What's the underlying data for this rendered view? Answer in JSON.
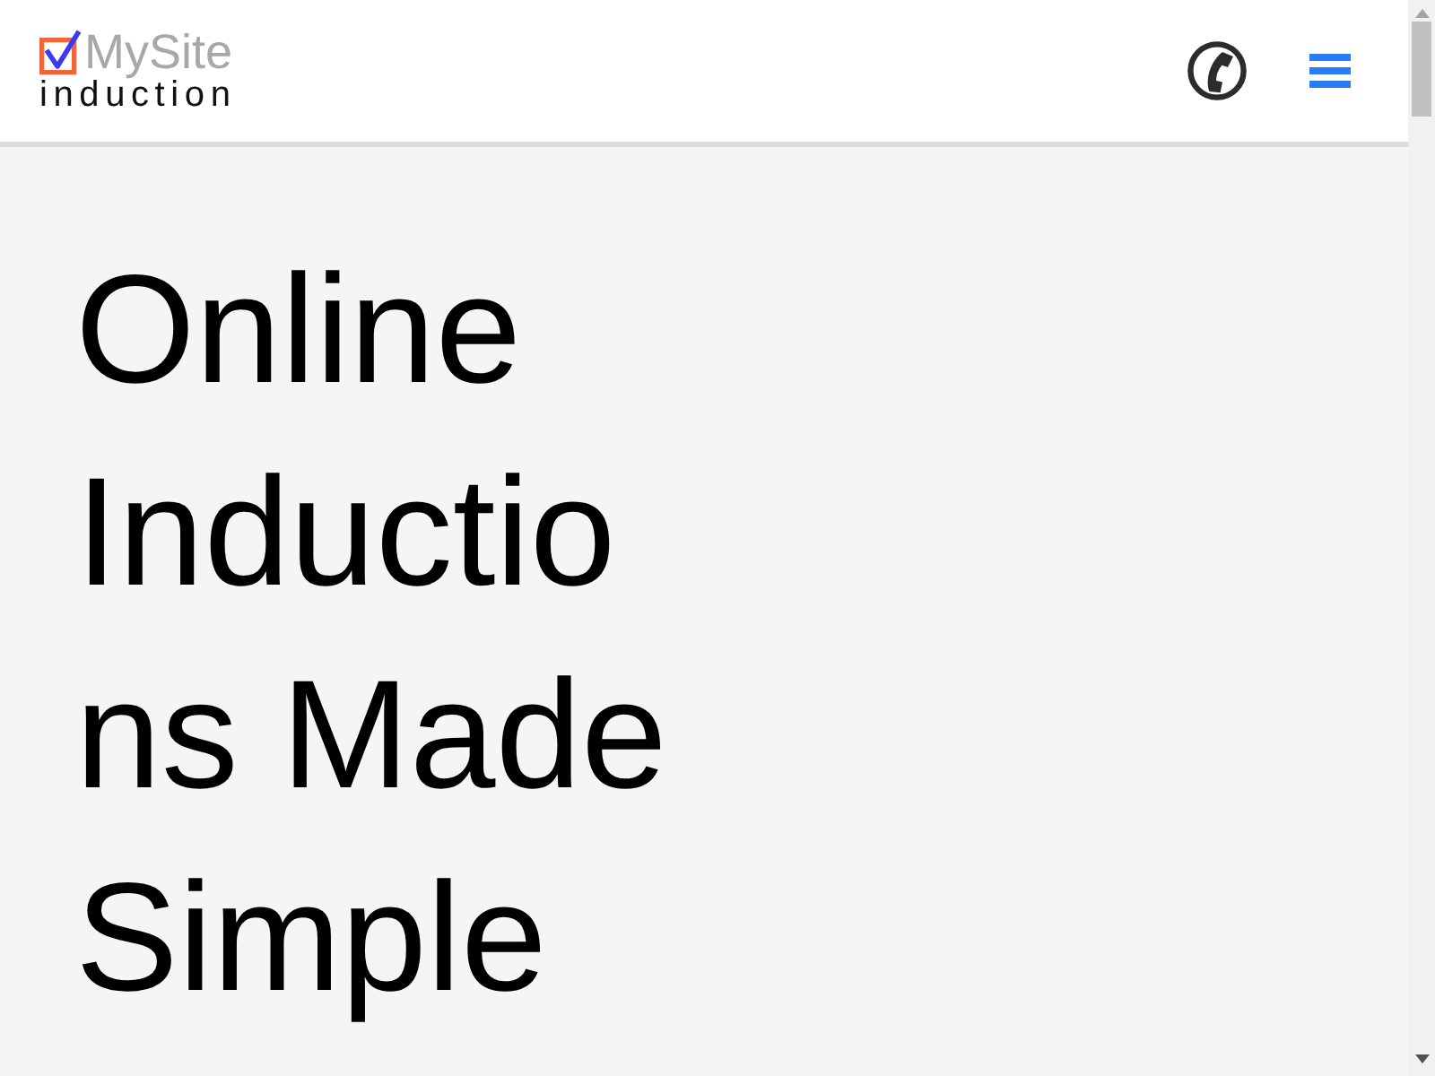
{
  "header": {
    "logo": {
      "brand": "MySite",
      "tagline": "induction"
    }
  },
  "hero": {
    "heading": "Online Inductions Made Simple"
  }
}
